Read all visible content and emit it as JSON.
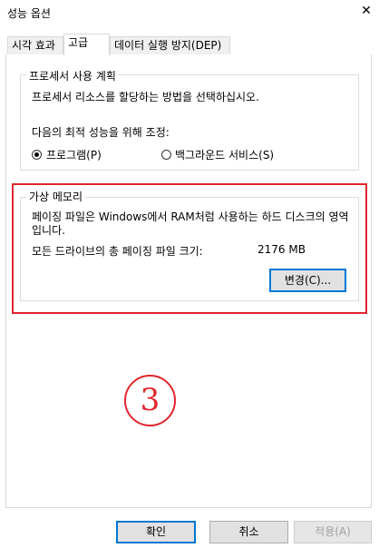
{
  "window": {
    "title": "성능 옵션",
    "close_glyph": "✕"
  },
  "tabs": [
    {
      "label": "시각 효과"
    },
    {
      "label": "고급"
    },
    {
      "label": "데이터 실행 방지(DEP)"
    }
  ],
  "processor": {
    "legend": "프로세서 사용 계획",
    "description": "프로세서 리소스를 할당하는 방법을 선택하십시오.",
    "adjust_label": "다음의 최적 성능을 위해 조정:",
    "option_programs": "프로그램(P)",
    "option_services": "백그라운드 서비스(S)",
    "selected": "programs"
  },
  "virtual_memory": {
    "legend": "가상 메모리",
    "description": "페이징 파일은 Windows에서 RAM처럼 사용하는 하드 디스크의 영역입니다.",
    "total_label": "모든 드라이브의 총 페이징 파일 크기:",
    "total_value": "2176 MB",
    "change_button": "변경(C)..."
  },
  "annotation": {
    "step_number": "3",
    "color": "#e0262e"
  },
  "footer": {
    "ok": "확인",
    "cancel": "취소",
    "apply": "적용(A)"
  }
}
